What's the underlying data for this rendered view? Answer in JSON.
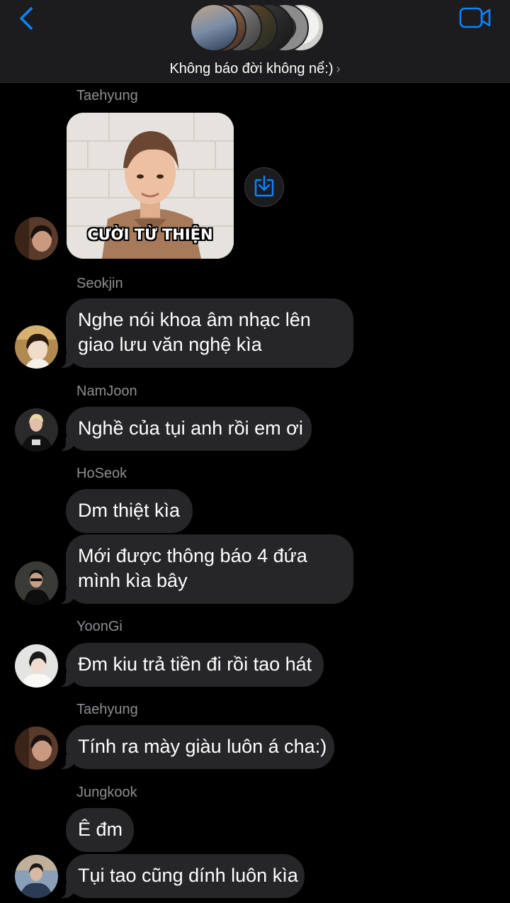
{
  "header": {
    "group_name": "Không báo đời không nể:)",
    "back_icon": "chevron-left-icon",
    "video_icon": "video-camera-icon",
    "accent_color": "#0a84ff"
  },
  "messages": [
    {
      "sender": "Taehyung",
      "type": "sticker",
      "sticker_caption": "CƯỜI TỪ THIỆN"
    },
    {
      "sender": "Seokjin",
      "bubbles": [
        "Nghe nói khoa âm nhạc lên\ngiao lưu văn nghệ kìa"
      ]
    },
    {
      "sender": "NamJoon",
      "bubbles": [
        "Nghề của tụi anh rồi em ơi"
      ]
    },
    {
      "sender": "HoSeok",
      "bubbles": [
        "Dm thiệt kìa",
        "Mới được thông báo 4 đứa\nmình kìa bây"
      ]
    },
    {
      "sender": "YoonGi",
      "bubbles": [
        "Đm kiu trả tiền đi rồi tao hát"
      ]
    },
    {
      "sender": "Taehyung",
      "bubbles": [
        "Tính ra mày giàu luôn á cha:)"
      ]
    },
    {
      "sender": "Jungkook",
      "bubbles": [
        "Ê đm",
        "Tụi tao cũng dính luôn kìa"
      ]
    }
  ]
}
